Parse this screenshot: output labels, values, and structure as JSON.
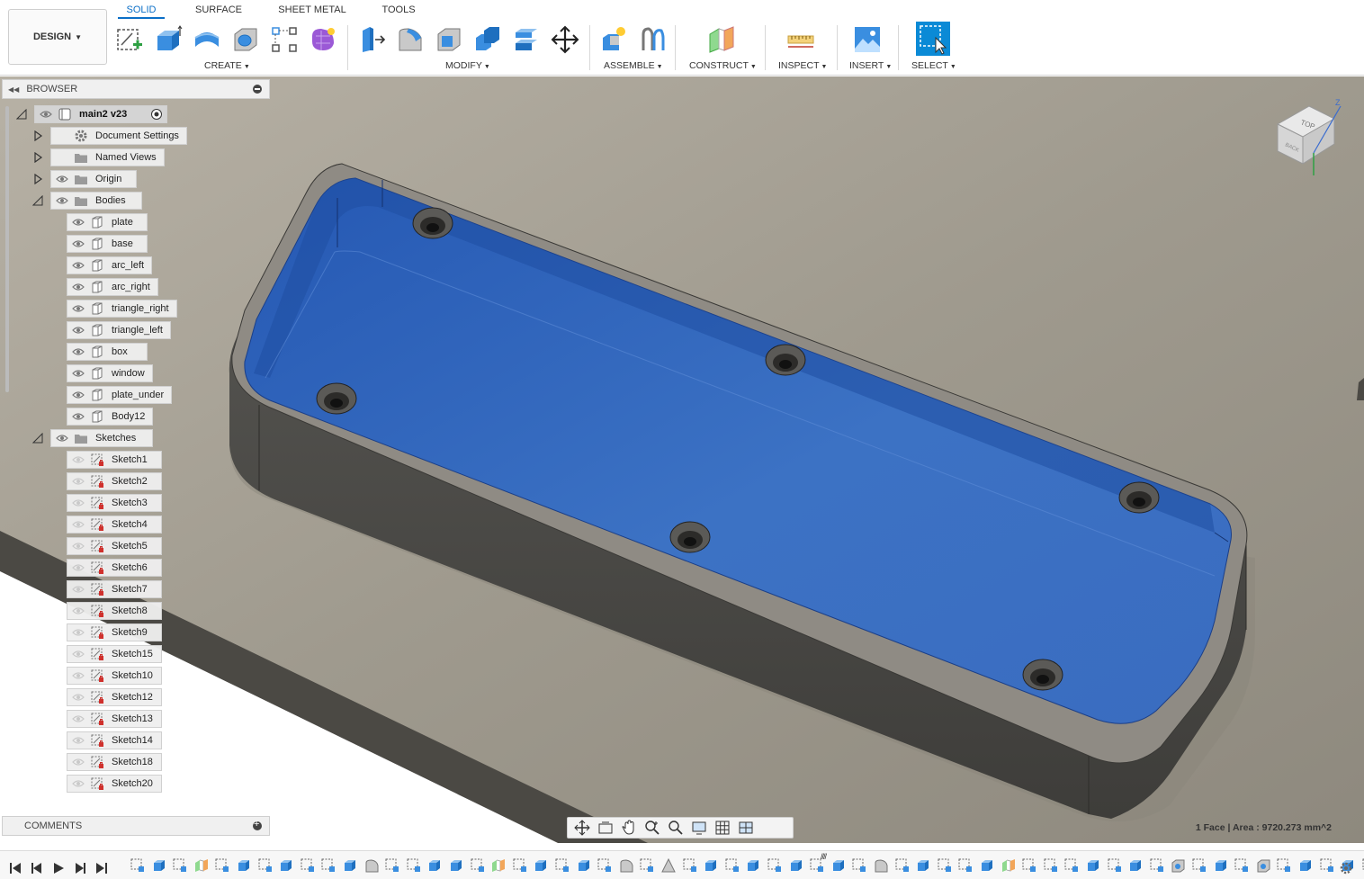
{
  "workspace": {
    "label": "DESIGN"
  },
  "tabs": [
    {
      "label": "SOLID",
      "active": true
    },
    {
      "label": "SURFACE",
      "active": false
    },
    {
      "label": "SHEET METAL",
      "active": false
    },
    {
      "label": "TOOLS",
      "active": false
    }
  ],
  "groups": {
    "create": "CREATE",
    "modify": "MODIFY",
    "assemble": "ASSEMBLE",
    "construct": "CONSTRUCT",
    "inspect": "INSPECT",
    "insert": "INSERT",
    "select": "SELECT"
  },
  "toolbar_icons": {
    "create": [
      "create-sketch-icon",
      "extrude-icon",
      "revolve-icon",
      "hole-icon",
      "rectangular-pattern-icon",
      "create-form-icon"
    ],
    "modify": [
      "press-pull-icon",
      "fillet-icon",
      "shell-icon",
      "combine-icon",
      "align-icon",
      "move-icon"
    ],
    "assemble": [
      "new-component-icon",
      "joint-icon"
    ],
    "construct": [
      "offset-plane-icon"
    ],
    "inspect": [
      "measure-icon"
    ],
    "insert": [
      "insert-image-icon"
    ],
    "select": [
      "select-icon"
    ]
  },
  "browser": {
    "title": "BROWSER",
    "root": "main2 v23",
    "folders": {
      "document_settings": "Document Settings",
      "named_views": "Named Views",
      "origin": "Origin",
      "bodies": "Bodies",
      "sketches": "Sketches"
    },
    "bodies": [
      "plate",
      "base",
      "arc_left",
      "arc_right",
      "triangle_right",
      "triangle_left",
      "box",
      "window",
      "plate_under",
      "Body12"
    ],
    "sketches": [
      "Sketch1",
      "Sketch2",
      "Sketch3",
      "Sketch4",
      "Sketch5",
      "Sketch6",
      "Sketch7",
      "Sketch8",
      "Sketch9",
      "Sketch15",
      "Sketch10",
      "Sketch12",
      "Sketch13",
      "Sketch14",
      "Sketch18",
      "Sketch20"
    ]
  },
  "comments": {
    "title": "COMMENTS"
  },
  "viewcube": {
    "top_label": "TOP",
    "back_label": "BACK",
    "z_label": "Z"
  },
  "status": {
    "selection_info": "1 Face | Area : 9720.273 mm^2"
  },
  "colors": {
    "accent": "#0b6fc7",
    "selected_face": "#2f62b8",
    "model_body": "#4a4a48",
    "ground": "#a39c8f"
  },
  "timeline": {
    "controls": [
      "skip-to-start-icon",
      "step-back-icon",
      "play-icon",
      "step-forward-icon",
      "skip-to-end-icon"
    ],
    "features": [
      "sketch",
      "extrude",
      "sketch",
      "construct",
      "sketch",
      "extrude",
      "sketch",
      "extrude",
      "sketch",
      "sketch",
      "extrude",
      "fillet",
      "sketch",
      "sketch",
      "extrude",
      "extrude",
      "sketch",
      "construct",
      "sketch",
      "extrude",
      "sketch",
      "extrude",
      "sketch",
      "fillet",
      "sketch",
      "triangle",
      "sketch",
      "extrude",
      "sketch",
      "extrude",
      "sketch",
      "extrude",
      "sketch",
      "extrude",
      "sketch",
      "fillet",
      "sketch",
      "extrude",
      "sketch",
      "sketch",
      "extrude",
      "construct",
      "sketch",
      "sketch",
      "sketch",
      "extrude",
      "sketch",
      "extrude",
      "sketch",
      "hole",
      "sketch",
      "extrude",
      "sketch",
      "hole",
      "sketch",
      "extrude",
      "sketch",
      "extrude",
      "sketch",
      "extrude",
      "sketch"
    ]
  }
}
